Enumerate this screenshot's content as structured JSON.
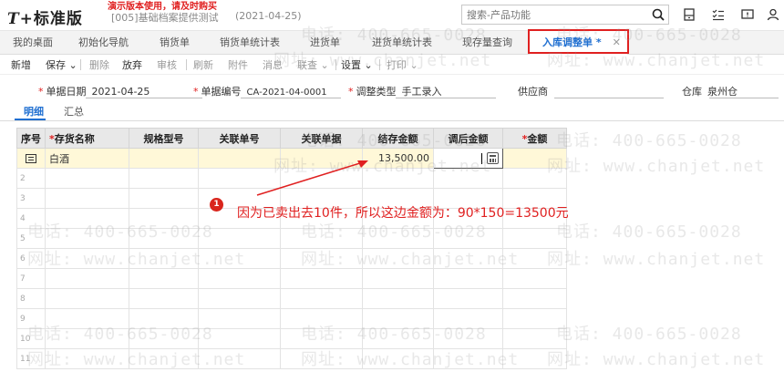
{
  "header": {
    "logo_mark": "T+",
    "logo_text": "标准版",
    "demo_warning": "演示版本使用，请及时购买",
    "company": "[005]基础档案提供测试",
    "date": "(2021-04-25)",
    "search_placeholder": "搜索-产品功能"
  },
  "tabs": [
    {
      "label": "我的桌面"
    },
    {
      "label": "初始化导航"
    },
    {
      "label": "销货单"
    },
    {
      "label": "销货单统计表"
    },
    {
      "label": "进货单"
    },
    {
      "label": "进货单统计表"
    },
    {
      "label": "现存量查询"
    },
    {
      "label": "入库调整单 *",
      "close": "✕"
    }
  ],
  "toolbar": {
    "add": "新增",
    "save": "保存",
    "delete": "删除",
    "abandon": "放弃",
    "audit": "审核",
    "refresh": "刷新",
    "attachment": "附件",
    "message": "消息",
    "link_query": "联查",
    "settings": "设置",
    "print": "打印"
  },
  "form": {
    "doc_date_label": "单据日期",
    "doc_date_value": "2021-04-25",
    "doc_no_label": "单据编号",
    "doc_no_value": "CA-2021-04-0001",
    "adjust_type_label": "调整类型",
    "adjust_type_value": "手工录入",
    "supplier_label": "供应商",
    "warehouse_label": "仓库",
    "warehouse_value": "泉州仓"
  },
  "subtabs": {
    "detail": "明细",
    "summary": "汇总"
  },
  "grid": {
    "columns": {
      "seq": "序号",
      "name": "存货名称",
      "spec": "规格型号",
      "ref_no": "关联单号",
      "ref_doc": "关联单据",
      "stock_amount": "结存金额",
      "adjusted_amount": "调后金额",
      "amount": "金额"
    },
    "rows": [
      {
        "name": "白酒",
        "stock_amount": "13,500.00"
      }
    ],
    "row_numbers": [
      "2",
      "3",
      "4",
      "5",
      "6",
      "7",
      "8",
      "9",
      "10",
      "11"
    ]
  },
  "watermark": {
    "phone": "电话: 400-665-0028",
    "site": "网址: www.chanjet.net"
  },
  "annotation": {
    "badge": "1",
    "text": "因为已卖出去10件，所以这边金额为：90*150=13500元"
  },
  "colors": {
    "accent": "#1f6fd1",
    "annotation_red": "#e02020"
  }
}
